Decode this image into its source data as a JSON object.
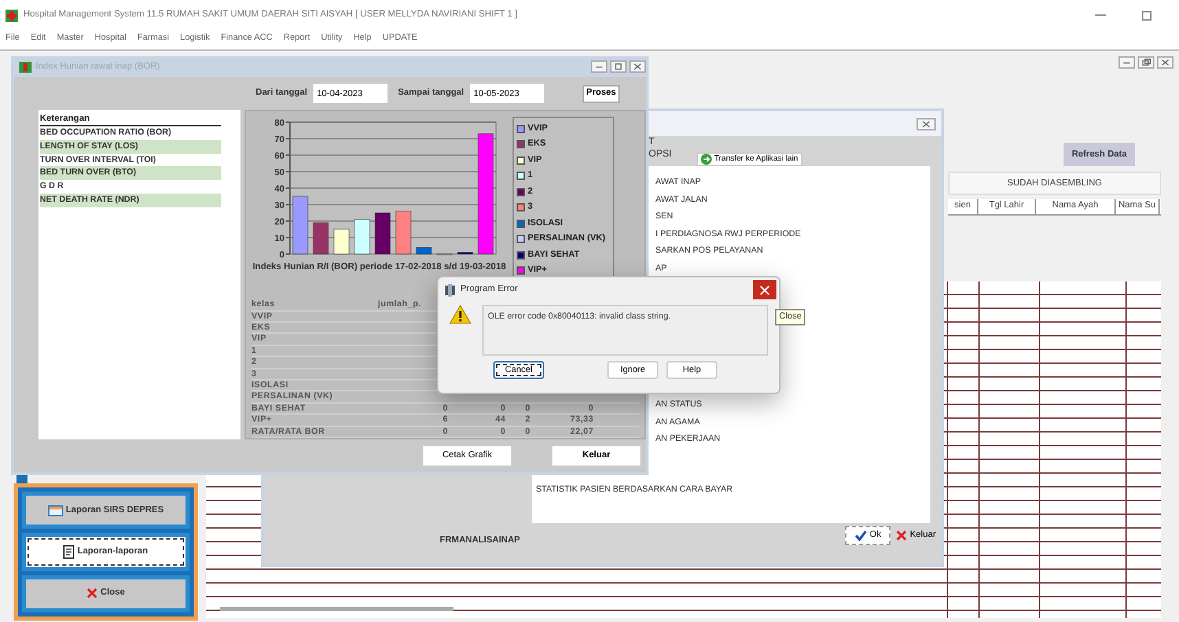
{
  "app": {
    "title": "Hospital Management System 11.5 RUMAH SAKIT UMUM DAERAH SITI AISYAH [ USER MELLYDA NAVIRIANI  SHIFT 1 ]",
    "menu": [
      "File",
      "Edit",
      "Master",
      "Hospital",
      "Farmasi",
      "Logistik",
      "Finance ACC",
      "Report",
      "Utility",
      "Help",
      "UPDATE"
    ]
  },
  "main_form": {
    "refresh_button": "Refresh Data",
    "grid_caption": "SUDAH DIASEMBLING",
    "grid_columns": [
      "sien",
      "Tgl Lahir",
      "Nama Ayah",
      "Nama Su"
    ],
    "side_buttons": [
      {
        "label": "Laporan SIRS DEPRES",
        "kind": "report",
        "focused": false
      },
      {
        "label": "Laporan-laporan",
        "kind": "print",
        "focused": true
      },
      {
        "label": "Close",
        "kind": "close",
        "focused": false
      }
    ]
  },
  "report_window": {
    "header": [
      "T",
      "OPSI"
    ],
    "transfer_button": "Transfer ke Aplikasi lain",
    "items": [
      {
        "label": "AWAT INAP",
        "kind": "clipped"
      },
      {
        "label": "AWAT JALAN",
        "kind": "clipped"
      },
      {
        "label": "SEN",
        "kind": "clipped"
      },
      {
        "label": "I PERDIAGNOSA RWJ PERPERIODE",
        "kind": "clipped"
      },
      {
        "label": "SARKAN POS PELAYANAN",
        "kind": "clipped"
      },
      {
        "label": "AP",
        "kind": "clipped"
      },
      {
        "label": "AN STATUS",
        "kind": "clipped"
      },
      {
        "label": "AN AGAMA",
        "kind": "clipped"
      },
      {
        "label": "AN PEKERJAAN",
        "kind": "clipped"
      },
      {
        "label": "STATISTIK PASIEN BERDASARKAN CARA BAYAR",
        "kind": "full"
      }
    ],
    "ok_button": "Ok",
    "exit_button": "Keluar",
    "form_name": "FRMANALISAINAP"
  },
  "bor_window": {
    "title": "Index Hunian rawat inap (BOR)",
    "from_label": "Dari tanggal",
    "from_value": "10-04-2023",
    "to_label": "Sampai tanggal",
    "to_value": "10-05-2023",
    "process_button": "Proses",
    "list_header": "Keterangan",
    "indicators": [
      "BED OCCUPATION RATIO (BOR)",
      "LENGTH OF STAY (LOS)",
      "TURN OVER INTERVAL (TOI)",
      "BED TURN OVER (BTO)",
      "G D R",
      "NET DEATH RATE (NDR)"
    ],
    "chart_data": {
      "type": "bar",
      "grid": true,
      "title": "Indeks Hunian R/I (BOR)  periode 17-02-2018 s/d 19-03-2018",
      "ylim": [
        0,
        80
      ],
      "yticks": [
        0,
        10,
        20,
        30,
        40,
        50,
        60,
        70,
        80
      ],
      "series": [
        {
          "name": "VVIP",
          "color": "#9999ff",
          "values": [
            35
          ]
        },
        {
          "name": "EKS",
          "color": "#993366",
          "values": [
            19
          ]
        },
        {
          "name": "VIP",
          "color": "#ffffcc",
          "values": [
            15
          ]
        },
        {
          "name": "1",
          "color": "#ccffff",
          "values": [
            21
          ]
        },
        {
          "name": "2",
          "color": "#660066",
          "values": [
            25
          ]
        },
        {
          "name": "3",
          "color": "#ff8080",
          "values": [
            26
          ]
        },
        {
          "name": "ISOLASI",
          "color": "#0066cc",
          "values": [
            4
          ]
        },
        {
          "name": "PERSALINAN (VK)",
          "color": "#ccccff",
          "values": [
            0
          ]
        },
        {
          "name": "BAYI SEHAT",
          "color": "#000080",
          "values": [
            1
          ]
        },
        {
          "name": "VIP+",
          "color": "#ff00ff",
          "values": [
            73
          ]
        }
      ]
    },
    "table": {
      "columns": [
        "kelas",
        "jumlah_p."
      ],
      "rows": [
        [
          "VVIP"
        ],
        [
          "EKS"
        ],
        [
          "VIP"
        ],
        [
          "1"
        ],
        [
          "2"
        ],
        [
          "3"
        ],
        [
          "ISOLASI"
        ],
        [
          "PERSALINAN (VK)"
        ],
        [
          "BAYI SEHAT",
          "0",
          "0",
          "0",
          "0"
        ],
        [
          "VIP+",
          "6",
          "44",
          "2",
          "73,33"
        ],
        [
          "RATA/RATA BOR",
          "0",
          "0",
          "0",
          "22,07"
        ]
      ]
    },
    "print_button": "Cetak Grafik",
    "exit_button": "Keluar"
  },
  "error_dialog": {
    "title": "Program Error",
    "message": "OLE error code 0x80040113: invalid class string.",
    "buttons": [
      {
        "label": "Cancel",
        "focused": true
      },
      {
        "label": "Ignore",
        "focused": false
      },
      {
        "label": "Help",
        "focused": false
      }
    ]
  },
  "tooltip": "Close"
}
